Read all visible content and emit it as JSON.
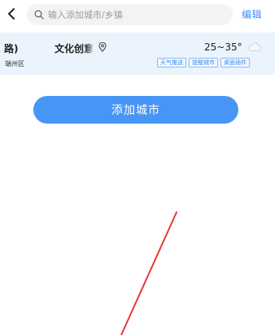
{
  "header": {
    "search_placeholder": "输入添加城市/乡镇",
    "edit_label": "编辑"
  },
  "city_card": {
    "left_title": "路)",
    "left_subtitle": "端州区",
    "place_name": "文化创意",
    "temperature": "25~35°",
    "weather_icon": "cloudy-icon",
    "tags": [
      "天气推送",
      "提醒城市",
      "桌面插件"
    ]
  },
  "add_city_label": "添加城市",
  "colors": {
    "accent": "#4796f6",
    "card_background": "#ebf3fd",
    "annotation_line": "#e53935"
  }
}
